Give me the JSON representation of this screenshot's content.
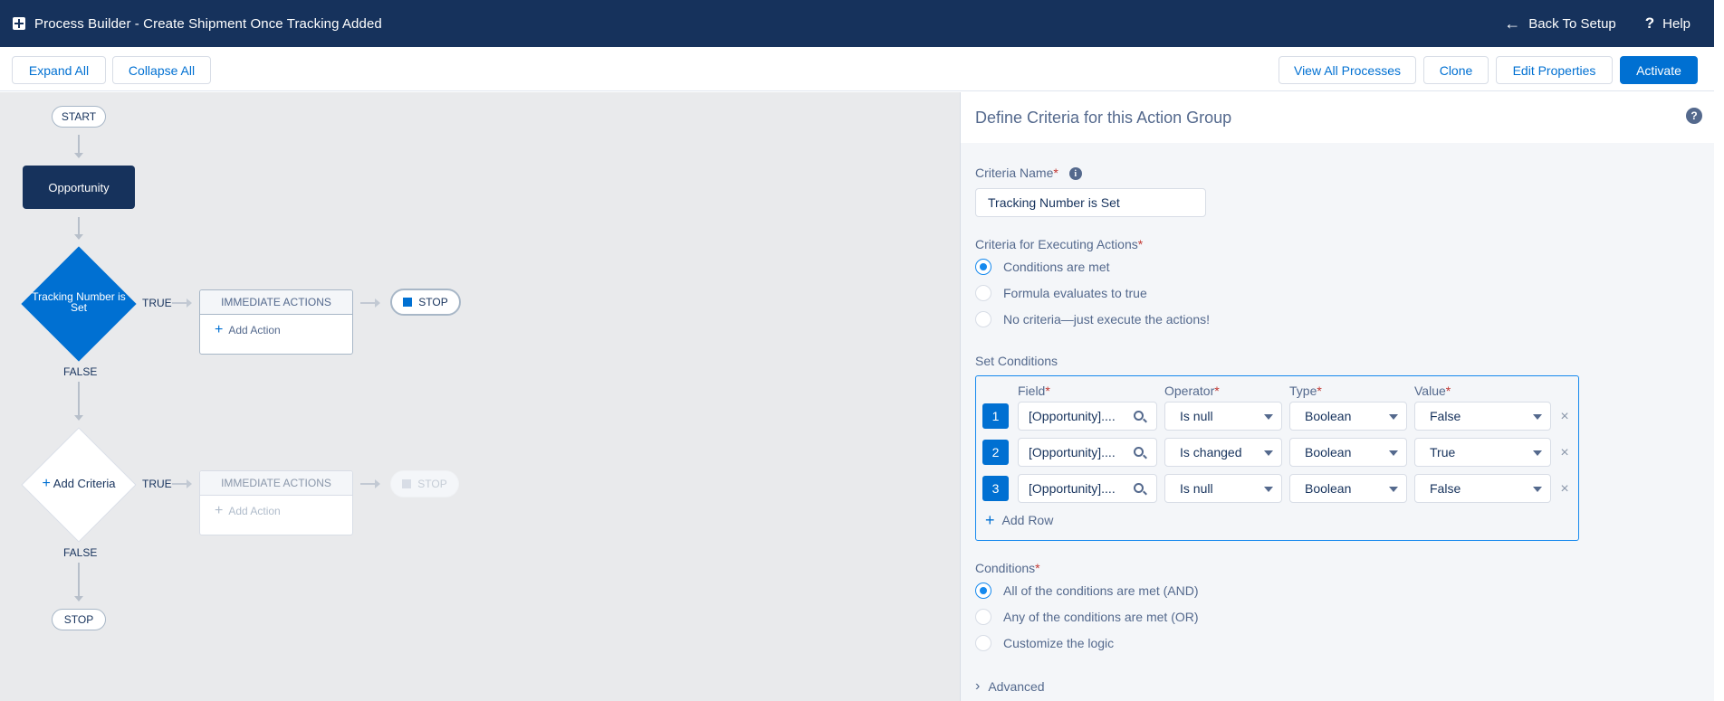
{
  "header": {
    "title": "Process Builder - Create Shipment Once Tracking Added",
    "back_label": "Back To Setup",
    "help_label": "Help"
  },
  "toolbar": {
    "expand_all": "Expand All",
    "collapse_all": "Collapse All",
    "view_all_processes": "View All Processes",
    "clone": "Clone",
    "edit_properties": "Edit Properties",
    "activate": "Activate"
  },
  "canvas": {
    "start_label": "START",
    "object_node": "Opportunity",
    "criteria_node": "Tracking Number is Set",
    "add_criteria": "Add Criteria",
    "true_label": "TRUE",
    "false_label": "FALSE",
    "immediate_actions": "IMMEDIATE ACTIONS",
    "add_action": "Add Action",
    "stop_label": "STOP"
  },
  "panel": {
    "title": "Define Criteria for this Action Group",
    "criteria_name_label": "Criteria Name",
    "criteria_name_value": "Tracking Number is Set",
    "executing_label": "Criteria for Executing Actions",
    "executing_options": [
      {
        "label": "Conditions are met",
        "selected": true
      },
      {
        "label": "Formula evaluates to true",
        "selected": false
      },
      {
        "label": "No criteria—just execute the actions!",
        "selected": false
      }
    ],
    "set_conditions_label": "Set Conditions",
    "columns": {
      "field": "Field",
      "operator": "Operator",
      "type": "Type",
      "value": "Value"
    },
    "conditions": [
      {
        "num": "1",
        "field": "[Opportunity]....",
        "operator": "Is null",
        "type": "Boolean",
        "value": "False"
      },
      {
        "num": "2",
        "field": "[Opportunity]....",
        "operator": "Is changed",
        "type": "Boolean",
        "value": "True"
      },
      {
        "num": "3",
        "field": "[Opportunity]....",
        "operator": "Is null",
        "type": "Boolean",
        "value": "False"
      }
    ],
    "add_row": "Add Row",
    "conditions_label": "Conditions",
    "logic_options": [
      {
        "label": "All of the conditions are met (AND)",
        "selected": true
      },
      {
        "label": "Any of the conditions are met (OR)",
        "selected": false
      },
      {
        "label": "Customize the logic",
        "selected": false
      }
    ],
    "advanced": "Advanced"
  },
  "colors": {
    "header_bg": "#16325c",
    "brand": "#0070d2",
    "canvas_bg": "#e9eaec",
    "panel_bg": "#f4f6f9"
  }
}
